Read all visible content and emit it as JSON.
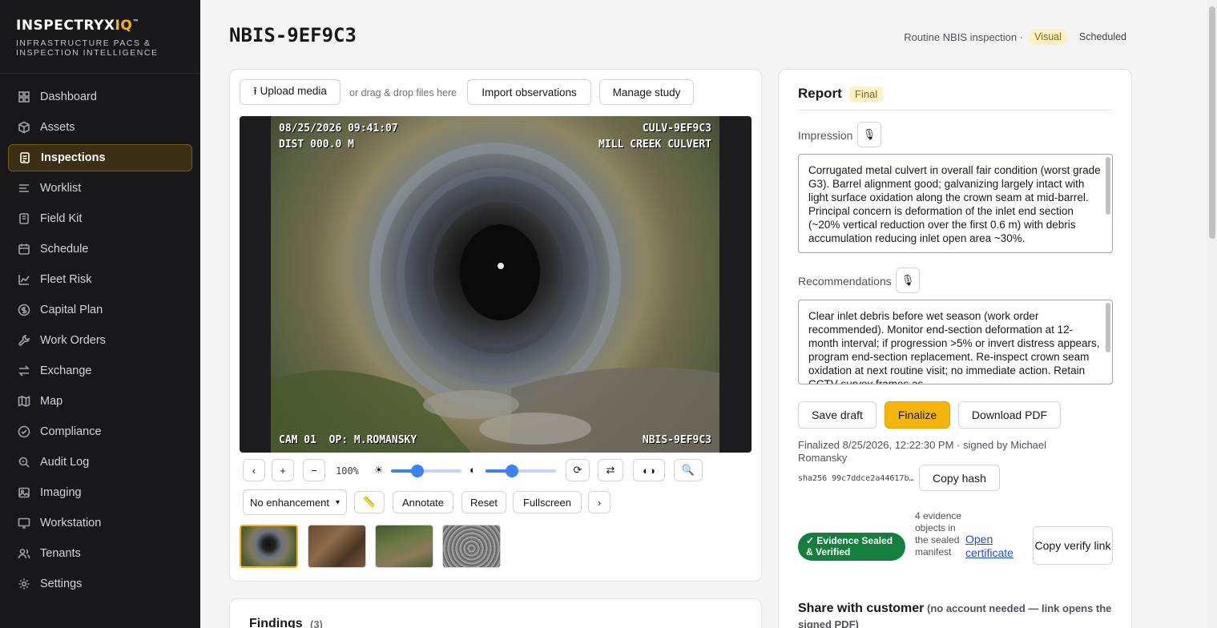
{
  "brand": {
    "name_main": "INSPECTRYX",
    "name_accent": "IQ",
    "tm": "™",
    "subtitle": "INFRASTRUCTURE PACS & INSPECTION INTELLIGENCE"
  },
  "sidebar": {
    "items": [
      {
        "label": "Dashboard",
        "icon": "grid-icon"
      },
      {
        "label": "Assets",
        "icon": "cube-icon"
      },
      {
        "label": "Inspections",
        "icon": "clipboard-icon",
        "active": true
      },
      {
        "label": "Worklist",
        "icon": "list-icon"
      },
      {
        "label": "Field Kit",
        "icon": "clipboard-check-icon"
      },
      {
        "label": "Schedule",
        "icon": "calendar-icon"
      },
      {
        "label": "Fleet Risk",
        "icon": "trend-icon"
      },
      {
        "label": "Capital Plan",
        "icon": "dollar-icon"
      },
      {
        "label": "Work Orders",
        "icon": "wrench-icon"
      },
      {
        "label": "Exchange",
        "icon": "arrows-icon"
      },
      {
        "label": "Map",
        "icon": "map-icon"
      },
      {
        "label": "Compliance",
        "icon": "shield-check-icon"
      },
      {
        "label": "Audit Log",
        "icon": "magnifier-icon"
      },
      {
        "label": "Imaging",
        "icon": "image-icon"
      },
      {
        "label": "Workstation",
        "icon": "monitor-icon"
      },
      {
        "label": "Tenants",
        "icon": "users-icon"
      },
      {
        "label": "Settings",
        "icon": "gear-icon"
      }
    ]
  },
  "header": {
    "title": "NBIS-9EF9C3",
    "inspection_type": "Routine NBIS inspection ·",
    "method_badge": "Visual",
    "status_badge": "Scheduled"
  },
  "viewer": {
    "upload_label": "⭱ Upload media",
    "drop_hint": "or drag & drop files here",
    "import_label": "Import observations",
    "manage_label": "Manage study",
    "overlay": {
      "timestamp": "08/25/2026 09:41:07",
      "distance": "DIST 000.0 M",
      "asset_id": "CULV-9EF9C3",
      "location": "MILL CREEK CULVERT",
      "camera": "CAM 01  OP: M.ROMANSKY",
      "inspection_id": "NBIS-9EF9C3"
    },
    "zoom_level": "100%",
    "brightness": 0.38,
    "contrast": 0.38,
    "enhancement_selected": "No enhancement",
    "annotate_label": "Annotate",
    "reset_label": "Reset",
    "fullscreen_label": "Fullscreen"
  },
  "findings": {
    "title": "Findings",
    "count": "(3)"
  },
  "report": {
    "title": "Report",
    "status_badge": "Final",
    "impression_label": "Impression",
    "impression_text": "Corrugated metal culvert in overall fair condition (worst grade G3). Barrel alignment good; galvanizing largely intact with light surface oxidation along the crown seam at mid-barrel. Principal concern is deformation of the inlet end section (~20% vertical reduction over the first 0.6 m) with debris accumulation reducing inlet open area ~30%.",
    "recommendations_label": "Recommendations",
    "recommendations_text": "Clear inlet debris before wet season (work order recommended). Monitor end-section deformation at 12-month interval; if progression >5% or invert distress appears, program end-section replacement. Re-inspect crown seam oxidation at next routine visit; no immediate action. Retain CCTV survey frames as",
    "save_label": "Save draft",
    "finalize_label": "Finalize",
    "download_label": "Download PDF",
    "finalized_text": "Finalized 8/25/2026, 12:22:30 PM · signed by Michael Romansky",
    "hash_text": "sha256 99c7ddce2a44617b…",
    "copy_hash_label": "Copy hash",
    "sealed_badge": "✓ Evidence Sealed & Verified",
    "sealed_desc": "4 evidence objects in the sealed manifest",
    "certificate_link": "Open certificate",
    "copy_verify_label": "Copy verify link",
    "share_title": "Share with customer",
    "share_note": "(no account needed — link opens the signed PDF)"
  },
  "colors": {
    "accent": "#f5b50a",
    "sidebar_bg": "#18181b",
    "sealed_green": "#15803d",
    "link": "#1d4ed8"
  }
}
